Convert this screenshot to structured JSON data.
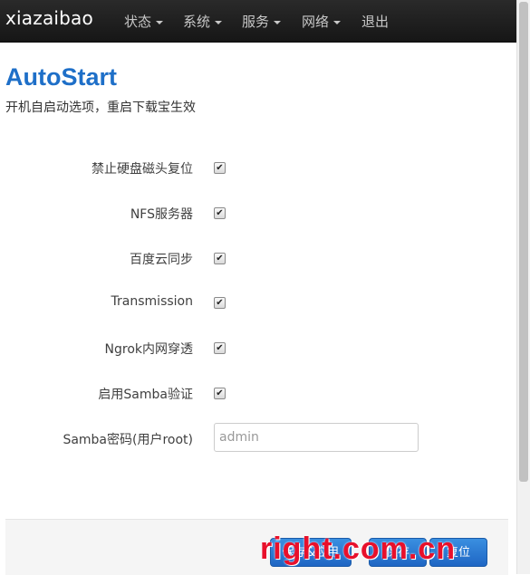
{
  "navbar": {
    "brand": "xiazaibao",
    "items": [
      {
        "label": "状态",
        "dropdown": true
      },
      {
        "label": "系统",
        "dropdown": true
      },
      {
        "label": "服务",
        "dropdown": true
      },
      {
        "label": "网络",
        "dropdown": true
      },
      {
        "label": "退出",
        "dropdown": false
      }
    ]
  },
  "page": {
    "title": "AutoStart",
    "description": "开机自启动选项，重启下载宝生效"
  },
  "options": [
    {
      "label": "禁止硬盘磁头复位",
      "checked": true
    },
    {
      "label": "NFS服务器",
      "checked": true
    },
    {
      "label": "百度云同步",
      "checked": true
    },
    {
      "label": "Transmission",
      "checked": true
    },
    {
      "label": "Ngrok内网穿透",
      "checked": true
    },
    {
      "label": "启用Samba验证",
      "checked": true
    }
  ],
  "samba_password": {
    "label": "Samba密码(用户root)",
    "value": "",
    "placeholder": "admin"
  },
  "actions": {
    "buttons": [
      "保存&应用",
      "保存",
      "复位"
    ]
  },
  "watermark": "right.com.cn",
  "colors": {
    "accent": "#1e6fc8",
    "navbar": "#1f1f1f",
    "button": "#2a7ad6",
    "watermark": "#e8102b"
  },
  "icons": {
    "checkbox": "checkmark-icon",
    "dropdown": "caret-down-icon"
  }
}
